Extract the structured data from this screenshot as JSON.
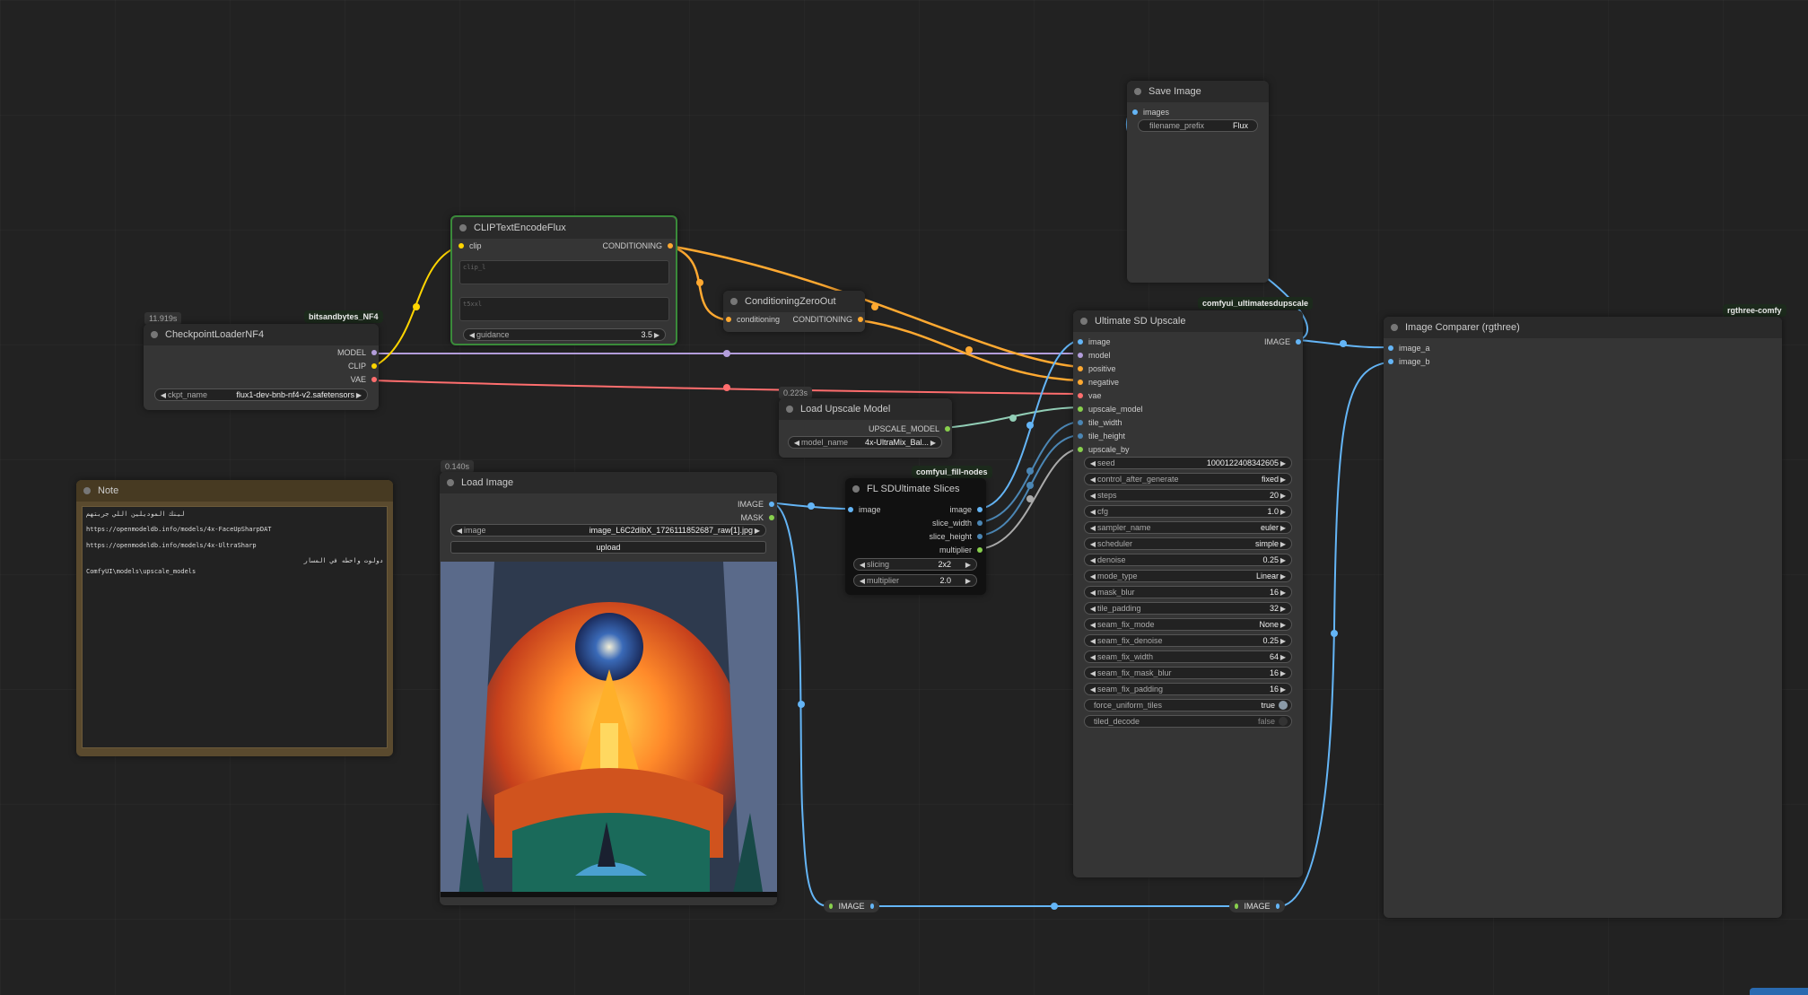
{
  "colors": {
    "model": "#b39ddb",
    "clip": "#ffd500",
    "vae": "#ff6e6e",
    "conditioning": "#ffa931",
    "image": "#64b5f6",
    "upscale_model": "#92ceb6",
    "int": "#4b86b4",
    "float": "#88d04d",
    "accent_green": "#a4e19b"
  },
  "checkpoint": {
    "title": "CheckpointLoaderNF4",
    "badge": "bitsandbytes_NF4",
    "timing": "11.919s",
    "out_model": "MODEL",
    "out_clip": "CLIP",
    "out_vae": "VAE",
    "w_label": "ckpt_name",
    "w_value": "flux1-dev-bnb-nf4-v2.safetensors"
  },
  "clipenc": {
    "title": "CLIPTextEncodeFlux",
    "in_clip": "clip",
    "out_cond": "CONDITIONING",
    "clip_l_placeholder": "clip_l",
    "t5xxl_placeholder": "t5xxl",
    "w_label": "guidance",
    "w_value": "3.5"
  },
  "zeroout": {
    "title": "ConditioningZeroOut",
    "in_cond": "conditioning",
    "out_cond": "CONDITIONING"
  },
  "saveimg": {
    "title": "Save Image",
    "in_images": "images",
    "w_label": "filename_prefix",
    "w_value": "Flux"
  },
  "upscalemodel": {
    "title": "Load Upscale Model",
    "timing": "0.223s",
    "out": "UPSCALE_MODEL",
    "w_label": "model_name",
    "w_value": "4x-UltraMix_Bal..."
  },
  "note": {
    "title": "Note",
    "lines": [
      "لينك الموديلين اللي جربتهم",
      "https://openmodeldb.info/models/4x-FaceUpSharpDAT",
      "https://openmodeldb.info/models/4x-UltraSharp",
      "دولوت واحطه في المسار",
      "ComfyUI\\models\\upscale_models"
    ]
  },
  "loadimage": {
    "title": "Load Image",
    "timing": "0.140s",
    "out_image": "IMAGE",
    "out_mask": "MASK",
    "w_label": "image",
    "w_value": "image_L6C2dIbX_1726111852687_raw[1].jpg",
    "upload": "upload"
  },
  "slices": {
    "title": "FL SDUltimate Slices",
    "badge": "comfyui_fill-nodes",
    "in_image": "image",
    "out_image": "image",
    "out_sw": "slice_width",
    "out_sh": "slice_height",
    "out_mul": "multiplier",
    "w1_label": "slicing",
    "w1_value": "2x2",
    "w2_label": "multiplier",
    "w2_value": "2.0"
  },
  "usdu": {
    "title": "Ultimate SD Upscale",
    "badge": "comfyui_ultimatesdupscale",
    "out_image": "IMAGE",
    "inputs": [
      "image",
      "model",
      "positive",
      "negative",
      "vae",
      "upscale_model",
      "tile_width",
      "tile_height",
      "upscale_by"
    ],
    "widgets": [
      {
        "label": "seed",
        "value": "1000122408342605"
      },
      {
        "label": "control_after_generate",
        "value": "fixed"
      },
      {
        "label": "steps",
        "value": "20"
      },
      {
        "label": "cfg",
        "value": "1.0"
      },
      {
        "label": "sampler_name",
        "value": "euler"
      },
      {
        "label": "scheduler",
        "value": "simple"
      },
      {
        "label": "denoise",
        "value": "0.25"
      },
      {
        "label": "mode_type",
        "value": "Linear"
      },
      {
        "label": "mask_blur",
        "value": "16"
      },
      {
        "label": "tile_padding",
        "value": "32"
      },
      {
        "label": "seam_fix_mode",
        "value": "None"
      },
      {
        "label": "seam_fix_denoise",
        "value": "0.25"
      },
      {
        "label": "seam_fix_width",
        "value": "64"
      },
      {
        "label": "seam_fix_mask_blur",
        "value": "16"
      },
      {
        "label": "seam_fix_padding",
        "value": "16"
      }
    ],
    "toggles": [
      {
        "label": "force_uniform_tiles",
        "value": "true"
      },
      {
        "label": "tiled_decode",
        "value": "false"
      }
    ]
  },
  "comparer": {
    "title": "Image Comparer (rgthree)",
    "badge": "rgthree-comfy",
    "in_a": "image_a",
    "in_b": "image_b"
  },
  "reroute1": {
    "label": "IMAGE"
  },
  "reroute2": {
    "label": "IMAGE"
  }
}
